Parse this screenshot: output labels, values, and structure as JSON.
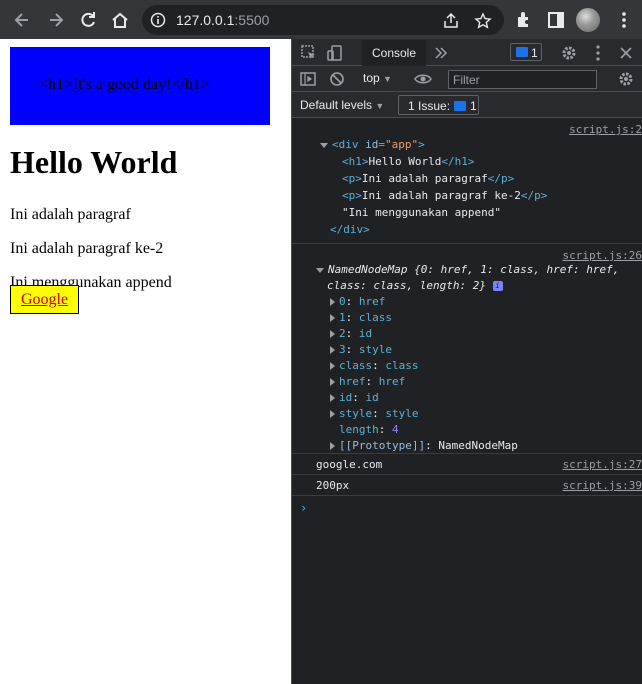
{
  "browser": {
    "url_host": "127.0.0.1",
    "url_port": ":5500"
  },
  "page": {
    "box_text": "<h1>It's a good day!</h1>",
    "heading": "Hello World",
    "para1": "Ini adalah paragraf",
    "para2": "Ini adalah paragraf ke-2",
    "para3": "Ini menggunakan append",
    "link": "Google"
  },
  "devtools": {
    "tab_console": "Console",
    "issue_count": "1",
    "context": "top",
    "filter_placeholder": "Filter",
    "default_levels": "Default levels",
    "issue_text": "1 Issue:",
    "issue_pill_count": "1"
  },
  "console": {
    "msg1": {
      "source": "script.js:2",
      "div_open_tag": "div",
      "div_attr": "id",
      "div_attr_val": "\"app\"",
      "h1_open": "<h1>",
      "h1_text": "Hello World",
      "h1_close": "</h1>",
      "p1_open": "<p>",
      "p1_text": "Ini adalah paragraf",
      "p1_close": "</p>",
      "p2_open": "<p>",
      "p2_text": "Ini adalah paragraf ke-2",
      "p2_close": "</p>",
      "text_node": "\"Ini menggunakan append\"",
      "div_close": "</div>"
    },
    "msg2": {
      "source": "script.js:26",
      "summary_name": "NamedNodeMap",
      "summary_rest1": "{0: href, 1: class, href: href,",
      "summary_rest2": "class: class, length: 2}",
      "props": [
        {
          "k": "0",
          "v": "href"
        },
        {
          "k": "1",
          "v": "class"
        },
        {
          "k": "2",
          "v": "id"
        },
        {
          "k": "3",
          "v": "style"
        },
        {
          "k": "class",
          "v": "class"
        },
        {
          "k": "href",
          "v": "href"
        },
        {
          "k": "id",
          "v": "id"
        },
        {
          "k": "style",
          "v": "style"
        }
      ],
      "length_key": "length",
      "length_val": "4",
      "proto_key": "[[Prototype]]",
      "proto_val": "NamedNodeMap"
    },
    "msg3": {
      "text": "google.com",
      "source": "script.js:27"
    },
    "msg4": {
      "text": "200px",
      "source": "script.js:39"
    },
    "prompt": "›"
  }
}
